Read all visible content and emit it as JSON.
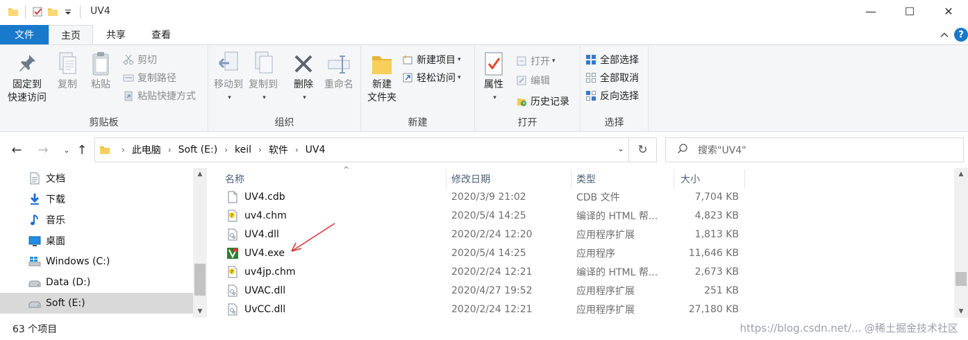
{
  "window": {
    "title": "UV4",
    "minimize_glyph": "—",
    "maximize_glyph": "☐",
    "close_glyph": "✕"
  },
  "ribbon_tabs": {
    "file": "文件",
    "home": "主页",
    "share": "共享",
    "view": "查看",
    "help_glyph": "?",
    "collapse_glyph": "^"
  },
  "clipboard": {
    "pin_line1": "固定到",
    "pin_line2": "快速访问",
    "copy": "复制",
    "paste": "粘贴",
    "cut": "剪切",
    "copy_path": "复制路径",
    "paste_shortcut": "粘贴快捷方式",
    "label": "剪贴板"
  },
  "organize": {
    "move_to": "移动到",
    "copy_to": "复制到",
    "delete": "删除",
    "rename": "重命名",
    "label": "组织"
  },
  "new_group": {
    "new_folder_line1": "新建",
    "new_folder_line2": "文件夹",
    "new_item": "新建项目",
    "easy_access": "轻松访问",
    "label": "新建"
  },
  "open_group": {
    "properties": "属性",
    "open": "打开",
    "edit": "编辑",
    "history": "历史记录",
    "label": "打开"
  },
  "select_group": {
    "select_all": "全部选择",
    "select_none": "全部取消",
    "invert": "反向选择",
    "label": "选择"
  },
  "address": {
    "breadcrumbs": [
      "此电脑",
      "Soft (E:)",
      "keil",
      "软件",
      "UV4"
    ],
    "search_placeholder": "搜索\"UV4\""
  },
  "nav_pane": {
    "items": [
      {
        "label": "文档",
        "icon": "documents-icon"
      },
      {
        "label": "下载",
        "icon": "downloads-icon"
      },
      {
        "label": "音乐",
        "icon": "music-icon"
      },
      {
        "label": "桌面",
        "icon": "desktop-icon"
      },
      {
        "label": "Windows (C:)",
        "icon": "windows-drive-icon"
      },
      {
        "label": "Data (D:)",
        "icon": "drive-icon"
      },
      {
        "label": "Soft (E:)",
        "icon": "drive-icon",
        "selected": true
      }
    ]
  },
  "file_list": {
    "columns": {
      "name": "名称",
      "modified": "修改日期",
      "type": "类型",
      "size": "大小"
    },
    "sort_glyph": "^",
    "rows": [
      {
        "name": "UV4.cdb",
        "modified": "2020/3/9 21:02",
        "type": "CDB 文件",
        "size": "7,704 KB",
        "icon": "blank-file-icon"
      },
      {
        "name": "uv4.chm",
        "modified": "2020/5/4 14:25",
        "type": "编译的 HTML 帮...",
        "size": "4,823 KB",
        "icon": "chm-help-icon"
      },
      {
        "name": "UV4.dll",
        "modified": "2020/2/24 12:20",
        "type": "应用程序扩展",
        "size": "1,813 KB",
        "icon": "dll-icon"
      },
      {
        "name": "UV4.exe",
        "modified": "2020/5/4 14:25",
        "type": "应用程序",
        "size": "11,646 KB",
        "icon": "keil-exe-icon"
      },
      {
        "name": "uv4jp.chm",
        "modified": "2020/2/24 12:21",
        "type": "编译的 HTML 帮...",
        "size": "2,673 KB",
        "icon": "chm-help-icon"
      },
      {
        "name": "UVAC.dll",
        "modified": "2020/4/27 19:52",
        "type": "应用程序扩展",
        "size": "251 KB",
        "icon": "dll-icon"
      },
      {
        "name": "UvCC.dll",
        "modified": "2020/2/24 12:21",
        "type": "应用程序扩展",
        "size": "27,180 KB",
        "icon": "dll-icon"
      }
    ]
  },
  "status": {
    "item_count": "63 个项目",
    "watermark": "https://blog.csdn.net/... @稀土掘金技术社区"
  },
  "colors": {
    "file_tab_bg": "#1979ca",
    "annotation_arrow": "#d9343a",
    "selection_bg": "#d9d9d9"
  }
}
